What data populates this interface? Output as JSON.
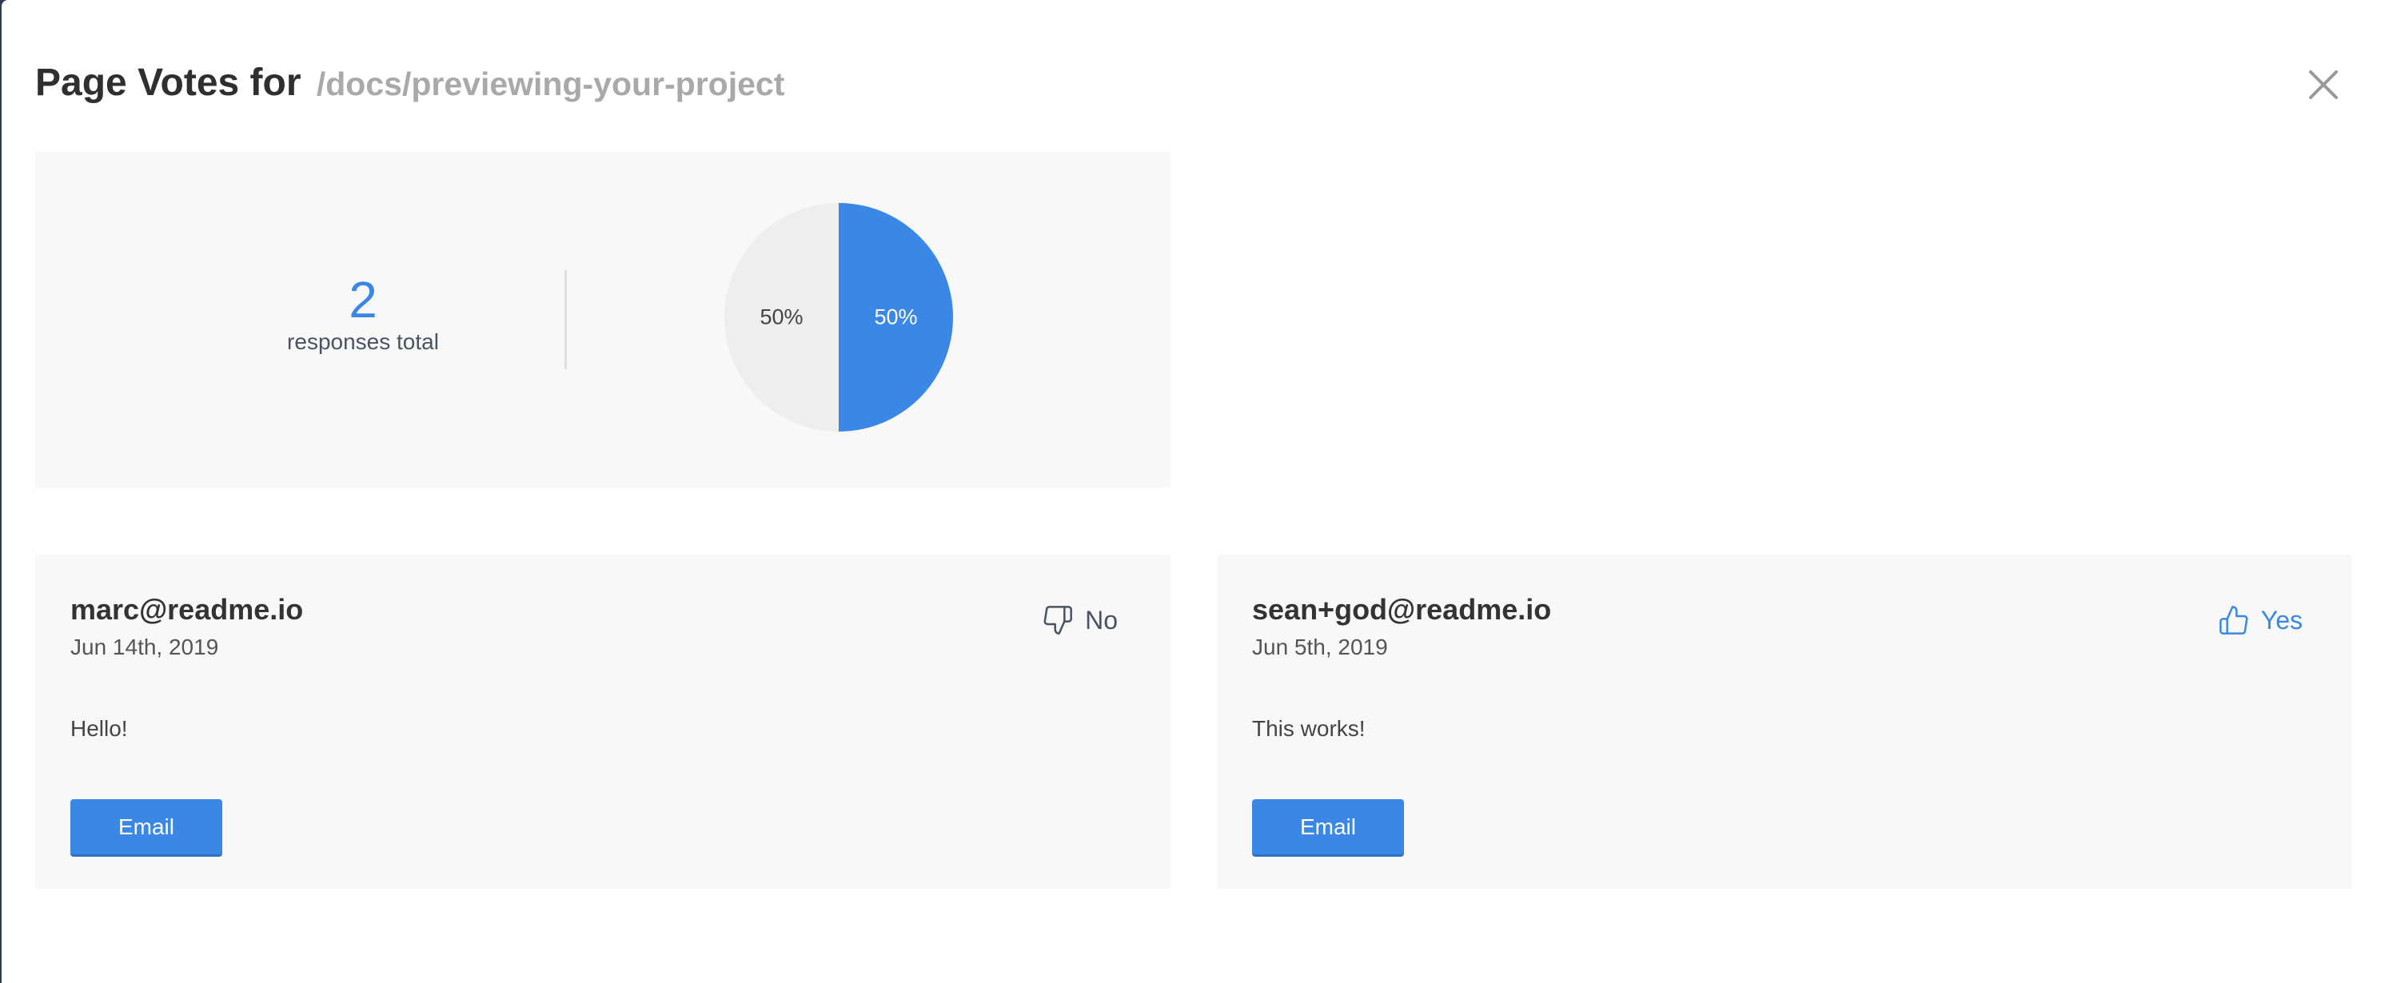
{
  "modal": {
    "title": "Page Votes for",
    "page_path": "/docs/previewing-your-project"
  },
  "stats": {
    "total": "2",
    "total_label": "responses total"
  },
  "chart_data": {
    "type": "pie",
    "slices": [
      {
        "label": "50%",
        "value": 50,
        "color": "#3a87e6"
      },
      {
        "label": "50%",
        "value": 50,
        "color": "#eeeeee"
      }
    ]
  },
  "votes": [
    {
      "email": "marc@readme.io",
      "date": "Jun 14th, 2019",
      "vote": "No",
      "message": "Hello!",
      "button": "Email"
    },
    {
      "email": "sean+god@readme.io",
      "date": "Jun 5th, 2019",
      "vote": "Yes",
      "message": "This works!",
      "button": "Email"
    }
  ],
  "colors": {
    "accent": "#3a87e6",
    "panel": "#f8f8f8"
  }
}
